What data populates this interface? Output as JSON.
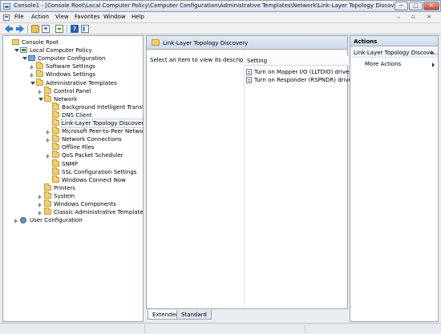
{
  "window": {
    "title": "Console1 - [Console Root\\Local Computer Policy\\Computer Configuration\\Administrative Templates\\Network\\Link-Layer Topology Discovery]",
    "minimize_glyph": "─",
    "restore_glyph": "□",
    "close_glyph": "✕",
    "mdi_controls": "– ▫ ×"
  },
  "menubar": {
    "items": [
      "File",
      "Action",
      "View",
      "Favorites",
      "Window",
      "Help"
    ]
  },
  "toolbar": {
    "help_glyph": "?",
    "icons": [
      "back-arrow-icon",
      "forward-arrow-icon",
      "up-folder-icon",
      "show-hide-tree-icon",
      "export-list-icon",
      "help-icon",
      "show-hide-action-pane-icon"
    ]
  },
  "tree": {
    "nodes": [
      {
        "label": "Console Root",
        "depth": 0,
        "icon": "root-folder-icon",
        "expand": "none"
      },
      {
        "label": "Local Computer Policy",
        "depth": 1,
        "icon": "policy-icon",
        "expand": "open"
      },
      {
        "label": "Computer Configuration",
        "depth": 2,
        "icon": "computer-icon",
        "expand": "open"
      },
      {
        "label": "Software Settings",
        "depth": 3,
        "icon": "folder-icon",
        "expand": "closed"
      },
      {
        "label": "Windows Settings",
        "depth": 3,
        "icon": "folder-icon",
        "expand": "closed"
      },
      {
        "label": "Administrative Templates",
        "depth": 3,
        "icon": "folder-icon",
        "expand": "open"
      },
      {
        "label": "Control Panel",
        "depth": 4,
        "icon": "folder-icon",
        "expand": "closed"
      },
      {
        "label": "Network",
        "depth": 4,
        "icon": "folder-icon",
        "expand": "open"
      },
      {
        "label": "Background Intelligent Transfer Se",
        "depth": 5,
        "icon": "folder-icon",
        "expand": "none"
      },
      {
        "label": "DNS Client",
        "depth": 5,
        "icon": "folder-icon",
        "expand": "none"
      },
      {
        "label": "Link-Layer Topology Discovery",
        "depth": 5,
        "icon": "folder-icon",
        "expand": "none",
        "selected": true
      },
      {
        "label": "Microsoft Peer-to-Peer Networkin",
        "depth": 5,
        "icon": "folder-icon",
        "expand": "closed"
      },
      {
        "label": "Network Connections",
        "depth": 5,
        "icon": "folder-icon",
        "expand": "closed"
      },
      {
        "label": "Offline Files",
        "depth": 5,
        "icon": "folder-icon",
        "expand": "none"
      },
      {
        "label": "QoS Packet Scheduler",
        "depth": 5,
        "icon": "folder-icon",
        "expand": "closed"
      },
      {
        "label": "SNMP",
        "depth": 5,
        "icon": "folder-icon",
        "expand": "none"
      },
      {
        "label": "SSL Configuration Settings",
        "depth": 5,
        "icon": "folder-icon",
        "expand": "none"
      },
      {
        "label": "Windows Connect Now",
        "depth": 5,
        "icon": "folder-icon",
        "expand": "none"
      },
      {
        "label": "Printers",
        "depth": 4,
        "icon": "folder-icon",
        "expand": "none"
      },
      {
        "label": "System",
        "depth": 4,
        "icon": "folder-icon",
        "expand": "closed"
      },
      {
        "label": "Windows Components",
        "depth": 4,
        "icon": "folder-icon",
        "expand": "closed"
      },
      {
        "label": "Classic Administrative Templates (ADM",
        "depth": 4,
        "icon": "folder-icon",
        "expand": "closed"
      },
      {
        "label": "User Configuration",
        "depth": 1,
        "icon": "user-icon",
        "expand": "closed"
      }
    ]
  },
  "center": {
    "header_title": "Link-Layer Topology Discovery",
    "description": "Select an item to view its description.",
    "column_header": "Setting",
    "settings": [
      "Turn on Mapper I/O (LLTDIO) driver",
      "Turn on Responder (RSPNDR) driver"
    ],
    "tabs": [
      "Extended",
      "Standard"
    ]
  },
  "actions": {
    "title": "Actions",
    "section": "Link-Layer Topology Discove...",
    "items": [
      "More Actions"
    ]
  },
  "colors": {
    "selection_outline": "#9aa5b5",
    "folder": "#f0cf6f",
    "header_gradient_top": "#e3eaf4",
    "header_gradient_bottom": "#cfdae9"
  }
}
